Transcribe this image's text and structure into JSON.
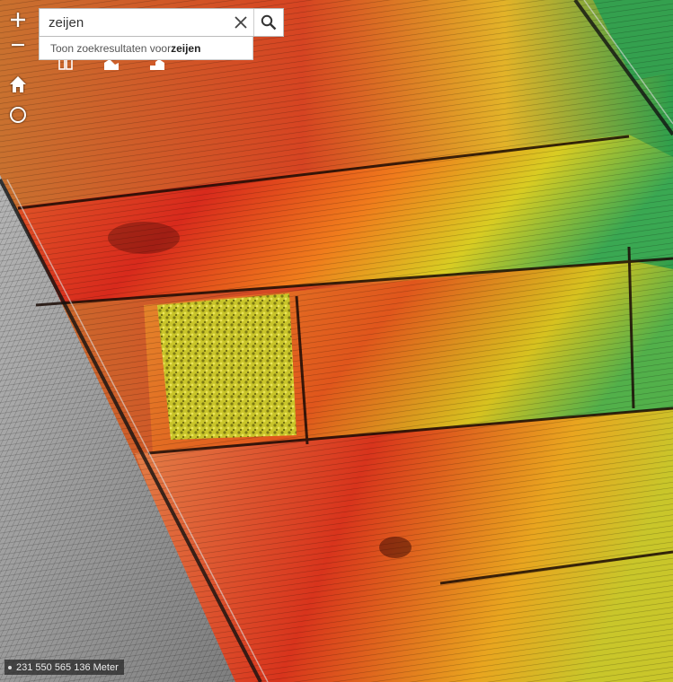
{
  "search": {
    "value": "zeijen",
    "placeholder": "",
    "suggestion_prefix": "Toon zoekresultaten voor ",
    "suggestion_term": "zeijen"
  },
  "controls": {
    "zoom_in_icon": "plus-icon",
    "zoom_out_icon": "minus-icon",
    "home_icon": "home-icon",
    "locate_icon": "circle-icon"
  },
  "widgets": [
    "book-icon",
    "terrain-icon",
    "terrain-step-icon"
  ],
  "coordinates": {
    "text": "231 550 565 136 Meter"
  },
  "colors": {
    "low": "#2fa84f",
    "mid_low": "#d6d020",
    "mid": "#f08a1a",
    "high": "#d8261a",
    "grey_terrain": "#9a9a9a"
  }
}
